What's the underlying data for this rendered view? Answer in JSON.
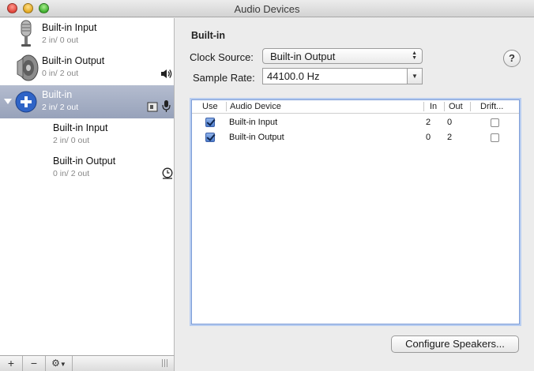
{
  "window": {
    "title": "Audio Devices"
  },
  "sidebar": {
    "devices": [
      {
        "name": "Built-in Input",
        "channels": "2 in/ 0 out",
        "icon": "microphone-icon",
        "status_icon": ""
      },
      {
        "name": "Built-in Output",
        "channels": "0 in/ 2 out",
        "icon": "speaker-icon",
        "status_icon": "volume-icon"
      },
      {
        "name": "Built-in",
        "channels": "2 in/ 2 out",
        "icon": "aggregate-plus-icon",
        "selected": true,
        "expanded": true,
        "status_icon": "input-output-icons"
      },
      {
        "name": "Built-in Input",
        "channels": "2 in/ 0 out",
        "sub": true,
        "status_icon": ""
      },
      {
        "name": "Built-in Output",
        "channels": "0 in/ 2 out",
        "sub": true,
        "status_icon": "clock-source-icon"
      }
    ],
    "toolbar": {
      "add": "+",
      "remove": "−",
      "gear": "⚙"
    }
  },
  "detail": {
    "title": "Built-in",
    "clock_source_label": "Clock Source:",
    "clock_source_value": "Built-in Output",
    "sample_rate_label": "Sample Rate:",
    "sample_rate_value": "44100.0 Hz",
    "help": "?",
    "table": {
      "columns": [
        "Use",
        "Audio Device",
        "In",
        "Out",
        "Drift..."
      ],
      "rows": [
        {
          "use": true,
          "device": "Built-in Input",
          "in": "2",
          "out": "0",
          "drift": false
        },
        {
          "use": true,
          "device": "Built-in Output",
          "in": "0",
          "out": "2",
          "drift": false
        }
      ]
    },
    "configure_button": "Configure Speakers..."
  },
  "colors": {
    "selection": "#9aa6bd",
    "focus_ring": "#7e9ed8",
    "accent_blue": "#2f64c7"
  }
}
